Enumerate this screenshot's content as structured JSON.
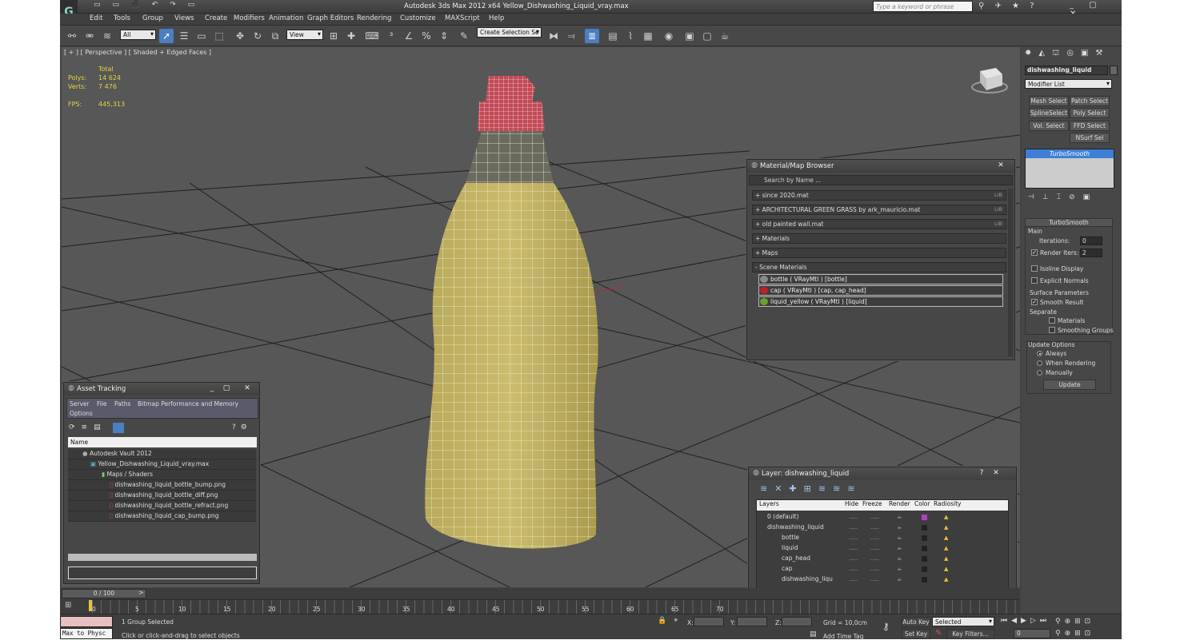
{
  "window": {
    "title": "Autodesk 3ds Max  2012 x64     Yellow_Dishwashing_Liquid_vray.max",
    "search_placeholder": "Type a keyword or phrase"
  },
  "menu": [
    "Edit",
    "Tools",
    "Group",
    "Views",
    "Create",
    "Modifiers",
    "Animation",
    "Graph Editors",
    "Rendering",
    "Customize",
    "MAXScript",
    "Help"
  ],
  "toolbar": {
    "selection_filter": "All",
    "reference_coord": "View",
    "named_selection": "Create Selection Se"
  },
  "viewport": {
    "label": "[ + ] [ Perspective ] [ Shaded + Edged Faces ]",
    "stats": {
      "total_label": "Total",
      "polys_label": "Polys:",
      "polys_value": "14 624",
      "verts_label": "Verts:",
      "verts_value": "7 476",
      "fps_label": "FPS:",
      "fps_value": "445,313"
    }
  },
  "command_panel": {
    "object_name": "dishwashing_liquid",
    "modifier_list": "Modifier List",
    "modifier_buttons": [
      "Mesh Select",
      "Patch Select",
      "SplineSelect",
      "Poly Select",
      "Vol. Select",
      "FFD Select",
      "NSurf Sel"
    ],
    "stack_item": "TurboSmooth",
    "rollout_title": "TurboSmooth",
    "main_label": "Main",
    "iterations_label": "Iterations:",
    "iterations_value": "0",
    "render_iters_label": "Render Iters:",
    "render_iters_value": "2",
    "isoline_label": "Isoline Display",
    "explicit_normals_label": "Explicit Normals",
    "surface_params_label": "Surface Parameters",
    "smooth_result_label": "Smooth Result",
    "separate_label": "Separate",
    "materials_label": "Materials",
    "smoothing_groups_label": "Smoothing Groups",
    "update_options_label": "Update Options",
    "always_label": "Always",
    "when_rendering_label": "When Rendering",
    "manually_label": "Manually",
    "update_button": "Update"
  },
  "material_browser": {
    "title": "Material/Map Browser",
    "search_placeholder": "Search by Name ...",
    "libraries": [
      {
        "label": "+ since 2020.mat",
        "tag": "LIB"
      },
      {
        "label": "+ ARCHITECTURAL GREEN GRASS by ark_mauricio.mat",
        "tag": "LIB"
      },
      {
        "label": "+ old painted wall.mat",
        "tag": "LIB"
      },
      {
        "label": "+ Materials",
        "tag": ""
      },
      {
        "label": "+ Maps",
        "tag": ""
      },
      {
        "label": "- Scene Materials",
        "tag": ""
      }
    ],
    "scene_materials": [
      {
        "name": "bottle  ( VRayMtl )  [bottle]",
        "color": "#8a8a8a"
      },
      {
        "name": "cap  ( VRayMtl )  [cap, cap_head]",
        "color": "#c02020"
      },
      {
        "name": "liquid_yellow  ( VRayMtl )  [liquid]",
        "color": "#6aa030"
      }
    ]
  },
  "asset_tracking": {
    "title": "Asset Tracking",
    "menu": [
      "Server",
      "File",
      "Paths",
      "Bitmap Performance and Memory",
      "Options"
    ],
    "column_name": "Name",
    "rows": [
      "Autodesk Vault 2012",
      "Yellow_Dishwashing_Liquid_vray.max",
      "Maps / Shaders",
      "dishwashing_liquid_bottle_bump.png",
      "dishwashing_liquid_bottle_diff.png",
      "dishwashing_liquid_bottle_refract.png",
      "dishwashing_liquid_cap_bump.png"
    ]
  },
  "layer_panel": {
    "title": "Layer: dishwashing_liquid",
    "columns": [
      "Layers",
      "Hide",
      "Freeze",
      "Render",
      "Color",
      "Radiosity"
    ],
    "rows": [
      {
        "name": "0 (default)",
        "indent": 0,
        "color": "#b040c0"
      },
      {
        "name": "dishwashing_liquid",
        "indent": 0,
        "color": "#222222"
      },
      {
        "name": "bottle",
        "indent": 1,
        "color": "#222222"
      },
      {
        "name": "liquid",
        "indent": 1,
        "color": "#222222"
      },
      {
        "name": "cap_head",
        "indent": 1,
        "color": "#222222"
      },
      {
        "name": "cap",
        "indent": 1,
        "color": "#222222"
      },
      {
        "name": "dishwashing_liqu",
        "indent": 1,
        "color": "#222222"
      }
    ],
    "dots": "....."
  },
  "timeline": {
    "frame_counter": "0 / 100",
    "ticks": [
      "0",
      "5",
      "10",
      "15",
      "20",
      "25",
      "30",
      "35",
      "40",
      "45",
      "50",
      "55",
      "60",
      "65",
      "70"
    ]
  },
  "status": {
    "script_label": "Max to Physc",
    "selection_text": "1 Group Selected",
    "prompt_text": "Click or click-and-drag to select objects",
    "x_label": "X:",
    "y_label": "Y:",
    "z_label": "Z:",
    "grid_text": "Grid = 10,0cm",
    "add_time_tag": "Add Time Tag",
    "auto_key": "Auto Key",
    "set_key": "Set Key",
    "selected_value": "Selected",
    "key_filters": "Key Filters...",
    "frame_value": "0"
  }
}
